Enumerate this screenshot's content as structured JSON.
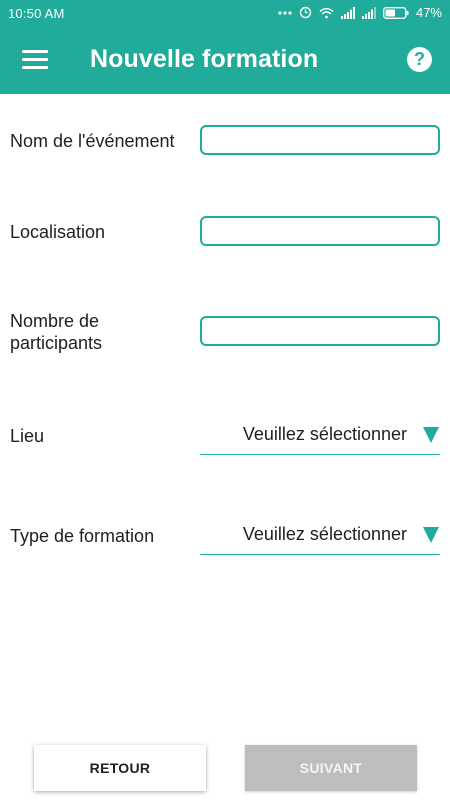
{
  "status_bar": {
    "time": "10:50 AM",
    "battery": "47%",
    "icons": [
      "more-dots-icon",
      "alarm-icon",
      "wifi-icon",
      "signal-icon",
      "signal-icon",
      "battery-icon"
    ]
  },
  "app_bar": {
    "title": "Nouvelle formation",
    "menu_icon": "hamburger-menu-icon",
    "help_icon": "help-icon",
    "help_glyph": "?"
  },
  "form": {
    "event_name": {
      "label": "Nom de l'événement",
      "value": ""
    },
    "location": {
      "label": "Localisation",
      "value": ""
    },
    "participants": {
      "label_line1": "Nombre de",
      "label_line2": "participants",
      "value": ""
    },
    "venue": {
      "label": "Lieu",
      "selected": "Veuillez sélectionner"
    },
    "training_type": {
      "label": "Type de formation",
      "selected": "Veuillez sélectionner"
    }
  },
  "buttons": {
    "back": "RETOUR",
    "next": "SUIVANT"
  },
  "colors": {
    "primary": "#21ab9a",
    "disabled": "#bdbdbd"
  }
}
